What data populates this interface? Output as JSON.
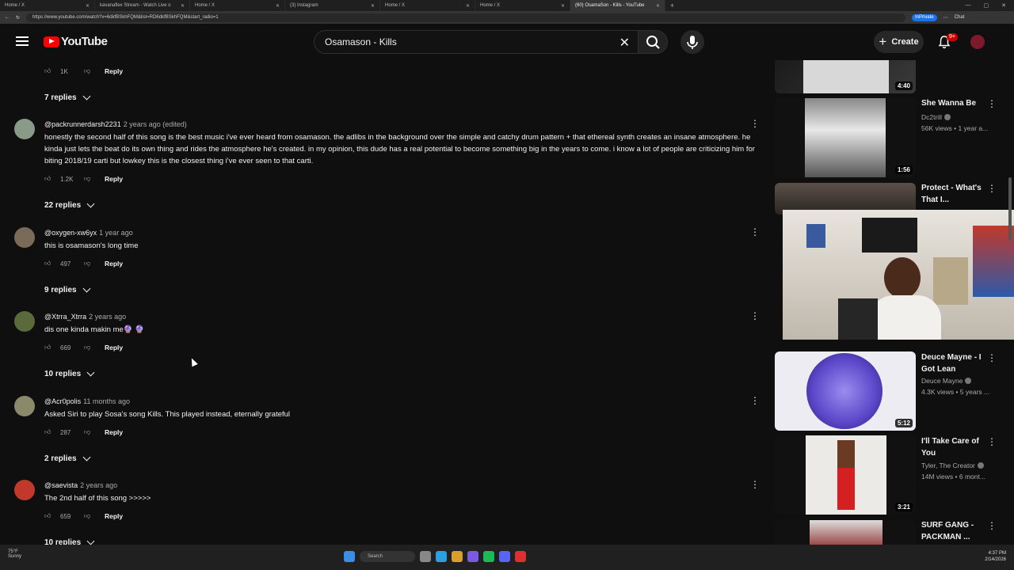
{
  "browser": {
    "tabs": [
      {
        "label": "Home / X",
        "active": false
      },
      {
        "label": "kavanaflex Stream - Watch Live o",
        "active": false
      },
      {
        "label": "Home / X",
        "active": false
      },
      {
        "label": "(3) Instagram",
        "active": false
      },
      {
        "label": "Home / X",
        "active": false
      },
      {
        "label": "Home / X",
        "active": false
      },
      {
        "label": "(60) OsamaSon - Kills - YouTube",
        "active": true
      }
    ],
    "url": "https://www.youtube.com/watch?v=6dkfBSkhFQM&list=RD6dkfBSkhFQM&start_radio=1",
    "inprivate": "InPrivate",
    "chat": "Chat"
  },
  "masthead": {
    "logo_text": "YouTube",
    "search_value": "Osamason - Kills",
    "create_label": "Create",
    "notif_badge": "9+"
  },
  "top_comment_tail": {
    "likes": "1K",
    "reply": "Reply",
    "replies": "7 replies"
  },
  "comments": [
    {
      "author": "@packrunnerdarsh2231",
      "time": "2 years ago (edited)",
      "text": "honestly the second half of this song is the best music i've ever heard from osamason. the adlibs in the background over the simple and catchy drum pattern + that ethereal synth creates an insane atmosphere. he kinda just lets the beat do its own thing and rides the atmosphere he's created. in my opinion, this dude has a real potential to become something big in the years to come. i know a lot of people are criticizing him for biting 2018/19 carti but lowkey this is the closest thing i've ever seen to that carti.",
      "likes": "1.2K",
      "reply": "Reply",
      "replies": "22 replies"
    },
    {
      "author": "@oxygen-xw6yx",
      "time": "1 year ago",
      "text": "this is osamason's long time",
      "likes": "497",
      "reply": "Reply",
      "replies": "9 replies"
    },
    {
      "author": "@Xtrra_Xtrra",
      "time": "2 years ago",
      "text": "dis one kinda makin me🔮 🔮",
      "likes": "669",
      "reply": "Reply",
      "replies": "10 replies"
    },
    {
      "author": "@Acr0polis",
      "time": "11 months ago",
      "text": "Asked Siri to play Sosa's song Kills. This played instead, eternally grateful",
      "likes": "287",
      "reply": "Reply",
      "replies": "2 replies"
    },
    {
      "author": "@saevista",
      "time": "2 years ago",
      "text": "The 2nd half of this song >>>>>",
      "likes": "659",
      "reply": "Reply",
      "replies": "10 replies"
    }
  ],
  "sidebar": {
    "videos": [
      {
        "duration": "4:40"
      },
      {
        "title": "She Wanna Be",
        "channel": "Dc2trill",
        "meta": "56K views • 1 year a...",
        "duration": "1:56"
      },
      {
        "title": "Protect - What's That I...",
        "channel": "",
        "meta": ""
      },
      {
        "title": "Deuce Mayne - I Got Lean",
        "channel": "Deuce Mayne",
        "meta": "4.3K views • 5 years ...",
        "duration": "5:12"
      },
      {
        "title": "I'll Take Care of You",
        "channel": "Tyler, The Creator",
        "meta": "14M views • 6 mont...",
        "duration": "3:21"
      },
      {
        "title": "SURF GANG - PACKMAN ...",
        "channel": "",
        "meta": ""
      }
    ]
  },
  "taskbar": {
    "weather_temp": "75°F",
    "weather_cond": "Sunny",
    "search_label": "Search",
    "time": "4:37 PM",
    "date": "2/14/2026"
  }
}
